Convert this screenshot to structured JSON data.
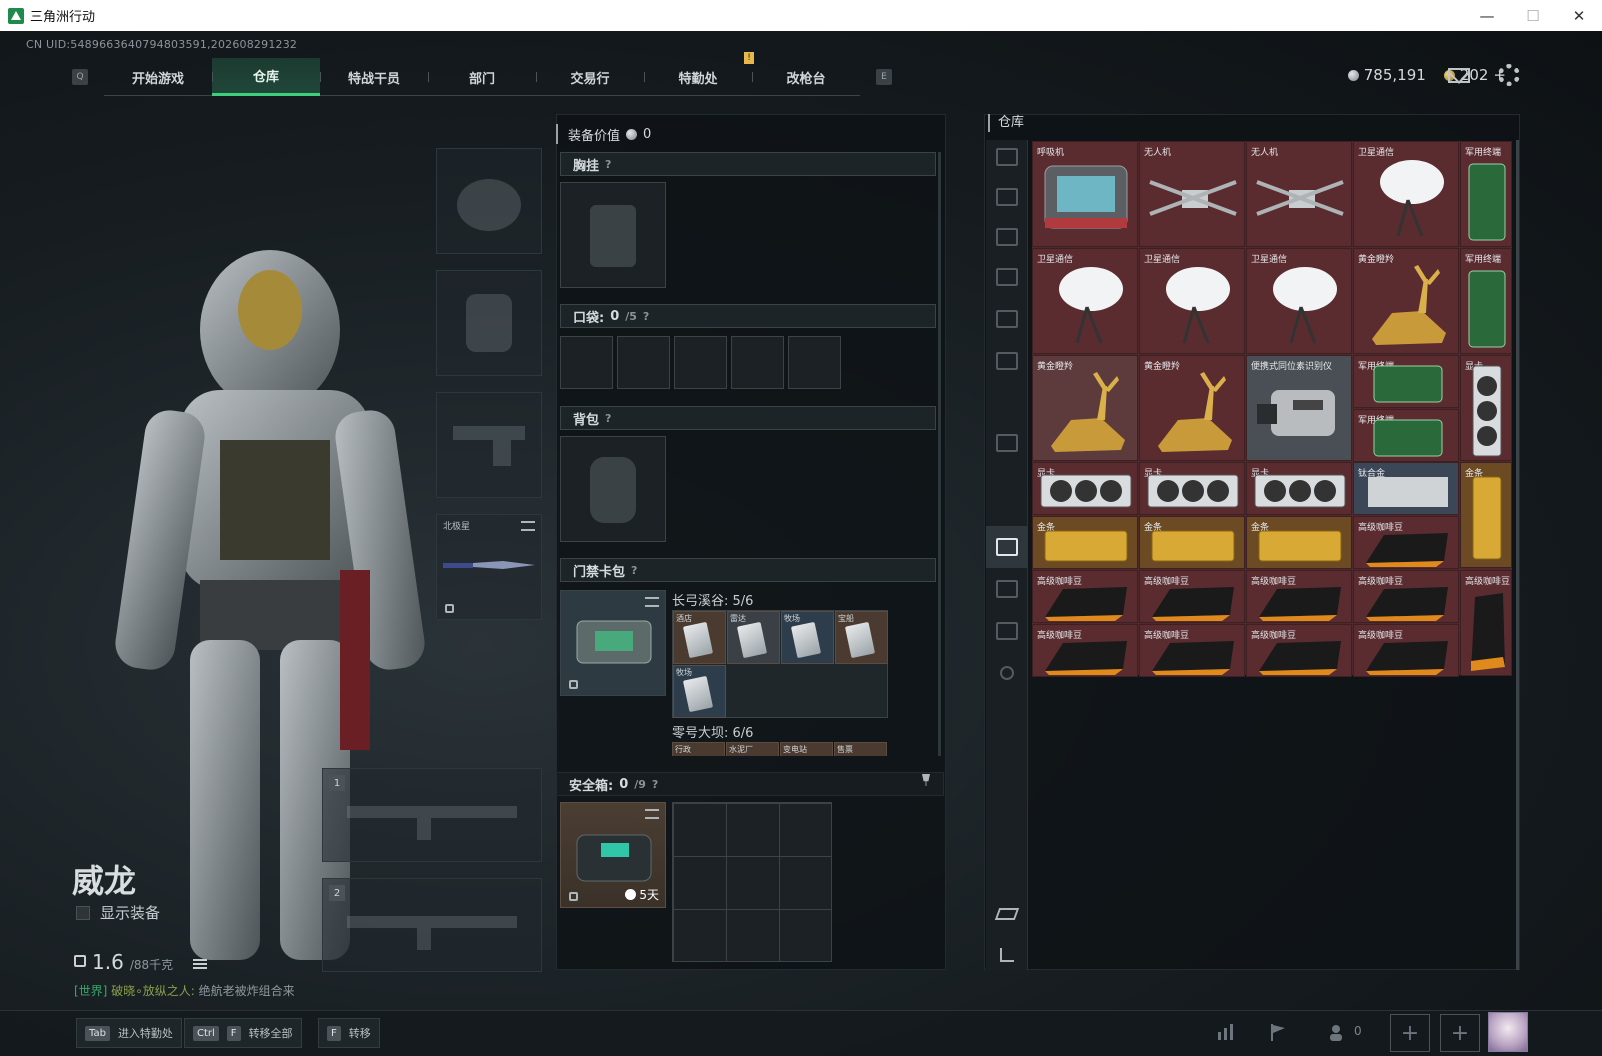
{
  "window": {
    "title": "三角洲行动",
    "minimize": "—",
    "maximize": "☐",
    "close": "✕"
  },
  "uid": "CN UID:5489663640794803591,202608291232",
  "nav": {
    "key_left": "Q",
    "key_right": "E",
    "tabs": [
      "开始游戏",
      "仓库",
      "特战干员",
      "部门",
      "交易行",
      "特勤处",
      "改枪台"
    ],
    "active_tab": "仓库",
    "badge": "!"
  },
  "currency": {
    "silver": "785,191",
    "gold": "202",
    "gold_add": "+"
  },
  "character": {
    "name": "威龙",
    "show_equipment_label": "显示装备",
    "weight": "1.6",
    "weight_max": "/88千克",
    "chat_channel": "[世界]",
    "chat_name": "破晓∘放纵之人:",
    "chat_message": "绝航老被炸组合来"
  },
  "equip_slots": {
    "melee_label": "北极星",
    "weapon1_num": "1",
    "weapon2_num": "2"
  },
  "loadout": {
    "equip_value_label": "装备价值",
    "equip_value": "0",
    "chest_rig": "胸挂",
    "pocket": "口袋:",
    "pocket_count": "0",
    "pocket_max": "/5",
    "backpack": "背包",
    "keycard_case": "门禁卡包",
    "help": "?",
    "group1_title": "长弓溪谷: 5/6",
    "group1_items": [
      "酒店",
      "雷达",
      "牧场",
      "宝船"
    ],
    "group1_item5": "牧场",
    "group2_title": "零号大坝: 6/6",
    "group2_items": [
      "行政",
      "水泥厂",
      "变电站",
      "售票"
    ],
    "safe_box": "安全箱:",
    "safe_count": "0",
    "safe_max": "/9",
    "timer": "5天"
  },
  "warehouse": {
    "title": "仓库",
    "items": [
      {
        "label": "呼吸机"
      },
      {
        "label": "无人机"
      },
      {
        "label": "无人机"
      },
      {
        "label": "卫星通信"
      },
      {
        "label": "军用终端"
      },
      {
        "label": "卫星通信"
      },
      {
        "label": "卫星通信"
      },
      {
        "label": "卫星通信"
      },
      {
        "label": "黄金瞪羚"
      },
      {
        "label": "军用终端"
      },
      {
        "label": "黄金瞪羚"
      },
      {
        "label": "黄金瞪羚"
      },
      {
        "label": "便携式同位素识别仪"
      },
      {
        "label": "军用终端"
      },
      {
        "label": "军用终端"
      },
      {
        "label": "显卡"
      },
      {
        "label": "显卡"
      },
      {
        "label": "显卡"
      },
      {
        "label": "显卡"
      },
      {
        "label": "钛合金"
      },
      {
        "label": "金条"
      },
      {
        "label": "金条"
      },
      {
        "label": "金条"
      },
      {
        "label": "金条"
      },
      {
        "label": "高级咖啡豆"
      },
      {
        "label": "高级咖啡豆"
      },
      {
        "label": "高级咖啡豆"
      },
      {
        "label": "高级咖啡豆"
      },
      {
        "label": "高级咖啡豆"
      },
      {
        "label": "高级咖啡豆"
      },
      {
        "label": "高级咖啡豆"
      },
      {
        "label": "高级咖啡豆"
      },
      {
        "label": "高级咖啡豆"
      },
      {
        "label": "高级咖啡豆"
      }
    ]
  },
  "bottom": {
    "hint1_key": "Tab",
    "hint1_text": "进入特勤处",
    "hint2_key1": "Ctrl",
    "hint2_key2": "F",
    "hint2_text": "转移全部",
    "hint3_key": "F",
    "hint3_text": "转移",
    "team_count": "0",
    "plus": "+"
  },
  "colors": {
    "accent": "#3fd07e",
    "item_red": "#5a2c30"
  }
}
